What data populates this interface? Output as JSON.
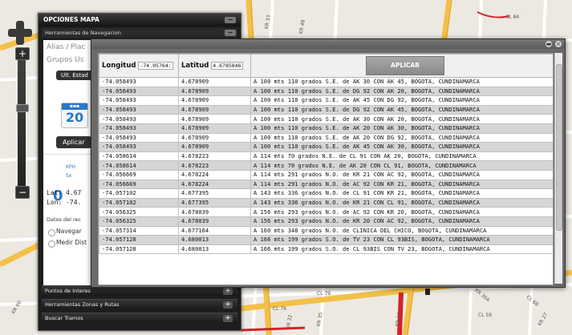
{
  "map": {
    "street_labels": [
      "CL 84",
      "KR 48",
      "KR 33",
      "KR 35",
      "CL 79",
      "CL 76",
      "CL 68",
      "KR 27",
      "KR 22",
      "KR 17",
      "CL 59",
      "KR 60",
      "KR 30A"
    ]
  },
  "panel": {
    "title": "OPCIONES MAPA",
    "nav_header": "Herramientas de Navegacion",
    "alias_label": "Alias / Plac",
    "groups_label": "Grupos Us",
    "last_state_button": "Ult. Estad",
    "calendar_day": "20",
    "apply_button": "Aplicar",
    "speed_value": "0",
    "speed_unit": "KPH",
    "speed_sub": "Sx",
    "lat_label": "Lat:  4.67",
    "lon_label": "Lon:  -74.",
    "route_data_label": "Datos del rec",
    "navigate_option": "Navegar",
    "measure_option": "Medir Dist",
    "footer_items": [
      "Puntos de Interes",
      "Herramientas Zonas y Rutas",
      "Buscar Tramos"
    ]
  },
  "window": {
    "col_longitude": "Longitud",
    "longitude_value": "-74.05764:",
    "col_latitude": "Latitud",
    "latitude_value": "4.6785846",
    "apply_button": "APLICAR",
    "rows": [
      {
        "lon": "-74.058493",
        "lat": "4.678909",
        "desc": "A 100 mts 110 grados S.E. de AK 30 CON AK 45, BOGOTA, CUNDINAMARCA"
      },
      {
        "lon": "-74.058493",
        "lat": "4.678909",
        "desc": "A 100 mts 110 grados S.E. de DG 92 CON AK 20, BOGOTA, CUNDINAMARCA"
      },
      {
        "lon": "-74.058493",
        "lat": "4.678909",
        "desc": "A 100 mts 110 grados S.E. de AK 45 CON DG 92, BOGOTA, CUNDINAMARCA"
      },
      {
        "lon": "-74.058493",
        "lat": "4.678909",
        "desc": "A 100 mts 110 grados S.E. de DG 92 CON AK 45, BOGOTA, CUNDINAMARCA"
      },
      {
        "lon": "-74.058493",
        "lat": "4.678909",
        "desc": "A 100 mts 110 grados S.E. de AK 30 CON AK 20, BOGOTA, CUNDINAMARCA"
      },
      {
        "lon": "-74.058493",
        "lat": "4.678909",
        "desc": "A 100 mts 110 grados S.E. de AK 20 CON AK 30, BOGOTA, CUNDINAMARCA"
      },
      {
        "lon": "-74.058493",
        "lat": "4.678909",
        "desc": "A 100 mts 110 grados S.E. de AK 20 CON DG 92, BOGOTA, CUNDINAMARCA"
      },
      {
        "lon": "-74.058493",
        "lat": "4.678909",
        "desc": "A 100 mts 110 grados S.E. de AK 45 CON AK 30, BOGOTA, CUNDINAMARCA"
      },
      {
        "lon": "-74.058614",
        "lat": "4.678223",
        "desc": "A 114 mts 70 grados N.E. de CL 91 CON AK 20, BOGOTA, CUNDINAMARCA"
      },
      {
        "lon": "-74.058614",
        "lat": "4.678223",
        "desc": "A 114 mts 70 grados N.E. de AK 20 CON CL 91, BOGOTA, CUNDINAMARCA"
      },
      {
        "lon": "-74.056669",
        "lat": "4.678224",
        "desc": "A 114 mts 291 grados N.O. de KR 21 CON AC 92, BOGOTA, CUNDINAMARCA"
      },
      {
        "lon": "-74.056669",
        "lat": "4.678224",
        "desc": "A 114 mts 291 grados N.O. de AC 92 CON KR 21, BOGOTA, CUNDINAMARCA"
      },
      {
        "lon": "-74.057102",
        "lat": "4.677395",
        "desc": "A 143 mts 336 grados N.O. de CL 91 CON KR 21, BOGOTA, CUNDINAMARCA"
      },
      {
        "lon": "-74.057102",
        "lat": "4.677395",
        "desc": "A 143 mts 336 grados N.O. de KR 21 CON CL 91, BOGOTA, CUNDINAMARCA"
      },
      {
        "lon": "-74.056325",
        "lat": "4.678039",
        "desc": "A 156 mts 293 grados N.O. de AC 92 CON KR 20, BOGOTA, CUNDINAMARCA"
      },
      {
        "lon": "-74.056325",
        "lat": "4.678039",
        "desc": "A 156 mts 293 grados N.O. de KR 20 CON AC 92, BOGOTA, CUNDINAMARCA"
      },
      {
        "lon": "-74.057314",
        "lat": "4.677164",
        "desc": "A 160 mts 348 grados N.O. de CLINICA DEL CHICO, BOGOTA, CUNDINAMARCA"
      },
      {
        "lon": "-74.057128",
        "lat": "4.680013",
        "desc": "A 166 mts 199 grados S.O. de TV 23 CON CL 93BIS, BOGOTA, CUNDINAMARCA"
      },
      {
        "lon": "-74.057128",
        "lat": "4.680013",
        "desc": "A 166 mts 199 grados S.O. de CL 93BIS CON TV 23, BOGOTA, CUNDINAMARCA"
      }
    ]
  }
}
